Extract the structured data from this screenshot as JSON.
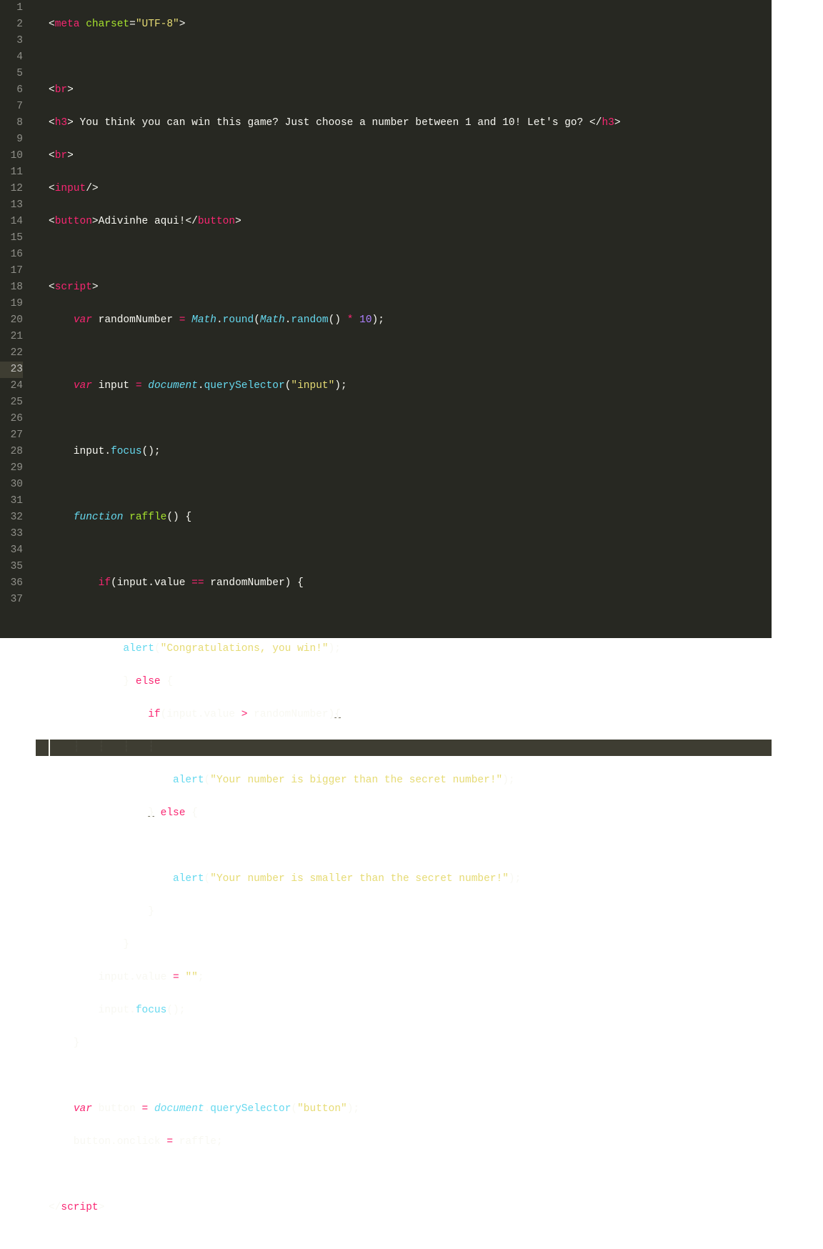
{
  "editor": {
    "theme": "monokai",
    "activeLine": 23,
    "lineNumbers": [
      "1",
      "2",
      "3",
      "4",
      "5",
      "6",
      "7",
      "8",
      "9",
      "10",
      "11",
      "12",
      "13",
      "14",
      "15",
      "16",
      "17",
      "18",
      "19",
      "20",
      "21",
      "22",
      "23",
      "24",
      "25",
      "26",
      "27",
      "28",
      "29",
      "30",
      "31",
      "32",
      "33",
      "34",
      "35",
      "36",
      "37"
    ],
    "tokens": {
      "meta": "meta",
      "charset_attr": "charset",
      "charset_val": "\"UTF-8\"",
      "br": "br",
      "h3": "h3",
      "h3_text": " You think you can win this game? Just choose a number between 1 and 10! Let's go? ",
      "input": "input",
      "button": "button",
      "button_text": "Adivinhe aqui!",
      "script": "script",
      "var": "var",
      "randomNumber": "randomNumber",
      "Math": "Math",
      "round": "round",
      "random": "random",
      "ten": "10",
      "input_var": "input",
      "document": "document",
      "querySelector": "querySelector",
      "q_input": "\"input\"",
      "q_button": "\"button\"",
      "focus": "focus",
      "function": "function",
      "raffle": "raffle",
      "if": "if",
      "else": "else",
      "value": "value",
      "alert": "alert",
      "msg_win": "\"Congratulations, you win!\"",
      "msg_big": "\"Your number is bigger than the secret number!\"",
      "msg_small": "\"Your number is smaller than the secret number!\"",
      "empty": "\"\"",
      "button_var": "button",
      "onclick": "onclick"
    }
  }
}
